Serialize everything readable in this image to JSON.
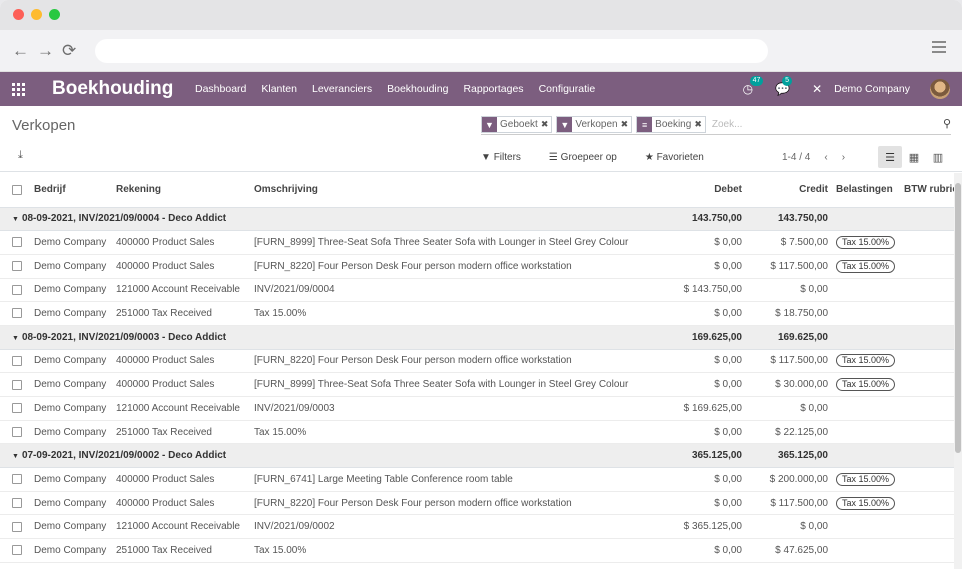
{
  "browser": {
    "back": "←",
    "forward": "→",
    "reload": "⟳"
  },
  "nav": {
    "app_name": "Boekhouding",
    "menu": [
      "Dashboard",
      "Klanten",
      "Leveranciers",
      "Boekhouding",
      "Rapportages",
      "Configuratie"
    ],
    "activity_badge": "47",
    "messages_badge": "5",
    "company": "Demo Company"
  },
  "control_panel": {
    "title": "Verkopen",
    "facets": [
      {
        "icon": "filter-icon",
        "label": "Geboekt"
      },
      {
        "icon": "filter-icon",
        "label": "Verkopen"
      },
      {
        "icon": "group-icon",
        "label": "Boeking"
      }
    ],
    "search_placeholder": "Zoek...",
    "filters_label": "Filters",
    "group_by_label": "Groepeer op",
    "favorites_label": "Favorieten",
    "pager": "1-4 / 4"
  },
  "table": {
    "columns": [
      "Bedrijf",
      "Rekening",
      "Omschrijving",
      "Debet",
      "Credit",
      "Belastingen",
      "BTW rubriek"
    ],
    "groups": [
      {
        "date": "08-09-2021",
        "rest": ", INV/2021/09/0004 - Deco Addict",
        "debit": "143.750,00",
        "credit": "143.750,00",
        "rows": [
          {
            "company": "Demo Company",
            "account": "400000 Product Sales",
            "label": "[FURN_8999] Three-Seat Sofa Three Seater Sofa with Lounger in Steel Grey Colour",
            "debit": "$ 0,00",
            "credit": "$ 7.500,00",
            "tax": "Tax 15.00%"
          },
          {
            "company": "Demo Company",
            "account": "400000 Product Sales",
            "label": "[FURN_8220] Four Person Desk Four person modern office workstation",
            "debit": "$ 0,00",
            "credit": "$ 117.500,00",
            "tax": "Tax 15.00%"
          },
          {
            "company": "Demo Company",
            "account": "121000 Account Receivable",
            "label": "INV/2021/09/0004",
            "debit": "$ 143.750,00",
            "credit": "$ 0,00",
            "tax": ""
          },
          {
            "company": "Demo Company",
            "account": "251000 Tax Received",
            "label": "Tax 15.00%",
            "debit": "$ 0,00",
            "credit": "$ 18.750,00",
            "tax": ""
          }
        ]
      },
      {
        "date": "08-09-2021",
        "rest": ", INV/2021/09/0003 - Deco Addict",
        "debit": "169.625,00",
        "credit": "169.625,00",
        "rows": [
          {
            "company": "Demo Company",
            "account": "400000 Product Sales",
            "label": "[FURN_8220] Four Person Desk Four person modern office workstation",
            "debit": "$ 0,00",
            "credit": "$ 117.500,00",
            "tax": "Tax 15.00%"
          },
          {
            "company": "Demo Company",
            "account": "400000 Product Sales",
            "label": "[FURN_8999] Three-Seat Sofa Three Seater Sofa with Lounger in Steel Grey Colour",
            "debit": "$ 0,00",
            "credit": "$ 30.000,00",
            "tax": "Tax 15.00%"
          },
          {
            "company": "Demo Company",
            "account": "121000 Account Receivable",
            "label": "INV/2021/09/0003",
            "debit": "$ 169.625,00",
            "credit": "$ 0,00",
            "tax": ""
          },
          {
            "company": "Demo Company",
            "account": "251000 Tax Received",
            "label": "Tax 15.00%",
            "debit": "$ 0,00",
            "credit": "$ 22.125,00",
            "tax": ""
          }
        ]
      },
      {
        "date": "07-09-2021",
        "rest": ", INV/2021/09/0002 - Deco Addict",
        "debit": "365.125,00",
        "credit": "365.125,00",
        "rows": [
          {
            "company": "Demo Company",
            "account": "400000 Product Sales",
            "label": "[FURN_6741] Large Meeting Table Conference room table",
            "debit": "$ 0,00",
            "credit": "$ 200.000,00",
            "tax": "Tax 15.00%"
          },
          {
            "company": "Demo Company",
            "account": "400000 Product Sales",
            "label": "[FURN_8220] Four Person Desk Four person modern office workstation",
            "debit": "$ 0,00",
            "credit": "$ 117.500,00",
            "tax": "Tax 15.00%"
          },
          {
            "company": "Demo Company",
            "account": "121000 Account Receivable",
            "label": "INV/2021/09/0002",
            "debit": "$ 365.125,00",
            "credit": "$ 0,00",
            "tax": ""
          },
          {
            "company": "Demo Company",
            "account": "251000 Tax Received",
            "label": "Tax 15.00%",
            "debit": "$ 0,00",
            "credit": "$ 47.625,00",
            "tax": ""
          }
        ]
      }
    ]
  },
  "colors": {
    "brand": "#7c5e7f",
    "badge": "#00a09d"
  }
}
